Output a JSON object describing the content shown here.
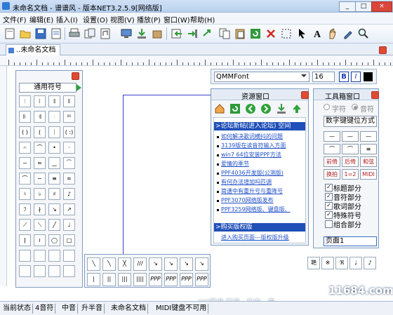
{
  "window": {
    "title": "未命名文档 - 谱谱风 - 版本NET3.2.5.9[网络版]",
    "controls": [
      "_",
      "□",
      "×"
    ]
  },
  "menu": [
    "文件(F)",
    "编辑(E)",
    "插入(I)",
    "设置(O)",
    "视图(V)",
    "播放(P)",
    "窗口(W)",
    "帮助(H)"
  ],
  "toolbar_icons": [
    "new-file-icon",
    "open-folder-icon",
    "save-icon",
    "document-icon",
    "print-icon",
    "monitor-icon",
    "download-icon",
    "import-icon",
    "export-icon",
    "copy-icon",
    "paste-icon",
    "refresh-icon",
    "delete-icon",
    "select-rect-icon",
    "pointer-icon",
    "text-icon",
    "hand-icon",
    "zoom-icon"
  ],
  "document_tab": "..未命名文档",
  "symbol_panel": {
    "dropdown": "通用符号",
    "symbols": [
      "𝄀",
      "𝄁",
      "𝄂",
      "𝄃",
      "𝄆",
      "𝄇",
      "𝄈",
      "𝄉",
      "( )",
      "( ",
      "｜",
      "( :)",
      "𝄐",
      "⌒",
      "•",
      "·",
      "~",
      "≈",
      "‿",
      "⁀",
      "⌒",
      "∼",
      "≡",
      "≈",
      "♮",
      "♭",
      "♯",
      "♪",
      "ℐ",
      "∤",
      "↘",
      "↗",
      "⟋",
      "⟍",
      "╱",
      "♩",
      "ǀ",
      "≀",
      "◯",
      "□"
    ]
  },
  "font_bar": {
    "font": "QMMFont",
    "size": "16",
    "bold": "B",
    "italic": "I"
  },
  "resource_window": {
    "title": "资源窗口",
    "nav_icons": [
      "home-icon",
      "refresh-icon",
      "back-icon",
      "forward-icon",
      "download-icon",
      "up-icon"
    ],
    "forum_header": ">论坛新帖(进入论坛)  空间",
    "links": [
      "如何解决歌词横抖的问题",
      "3139版在读音符输入方面",
      "win7 64位安装PPF方法",
      "爱情的季节",
      "PPF4036开发版(公测版)",
      "有何办法增加吗匹调",
      "简谱中有重升号与重降号",
      "PPF3070网络版发布",
      "PPF3259网络版、键盘版、"
    ],
    "buy_header": ">购买版权版",
    "buy_link": "进入购买页面---版权版升级"
  },
  "toolbox": {
    "title": "工具箱窗口",
    "radio_options": [
      "字符",
      "音符"
    ],
    "key_select": "数字键键位方式",
    "buttons": [
      "前倚",
      "后倚",
      "和弦",
      "换拍",
      "1=2",
      "MIDI"
    ],
    "checkboxes": [
      {
        "label": "标题部分",
        "checked": true
      },
      {
        "label": "音符部分",
        "checked": true
      },
      {
        "label": "歌词部分",
        "checked": true
      },
      {
        "label": "特殊符号",
        "checked": true
      },
      {
        "label": "组合部分",
        "checked": false
      }
    ],
    "page": "页面1"
  },
  "bottom_symbols": [
    "╲",
    "╲",
    "╳",
    "///",
    "↘",
    "↘",
    "↘",
    "↘",
    "|",
    "||",
    "|||",
    "||||",
    "PPP",
    "PPP",
    "PPP",
    "PPP"
  ],
  "right_symbols": [
    "艳",
    "※",
    "ℜ",
    "♩",
    "♪"
  ],
  "status": [
    "当前状态",
    "4音符",
    "中音",
    "升半音",
    "未命名文档",
    "MIDI键盘不可用"
  ],
  "watermark": {
    "left": "QM简谱 打谱、竹曲、春",
    "right": "11684.com"
  }
}
